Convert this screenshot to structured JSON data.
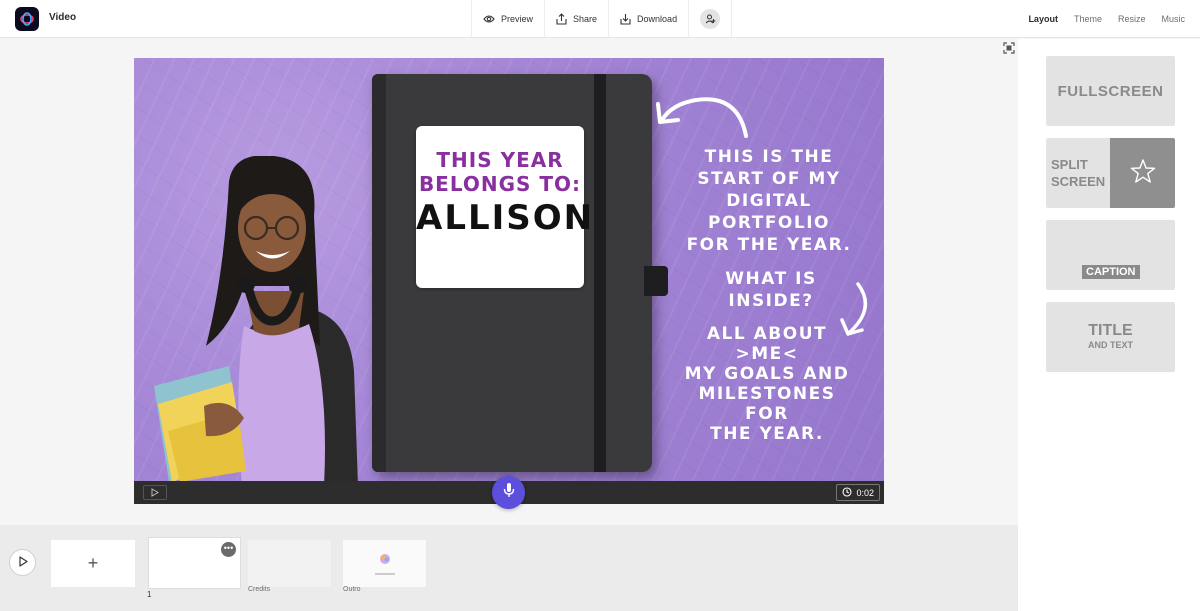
{
  "app": {
    "title": "Video"
  },
  "toolbar": {
    "preview_label": "Preview",
    "share_label": "Share",
    "download_label": "Download"
  },
  "right_tabs": [
    "Layout",
    "Theme",
    "Resize",
    "Music"
  ],
  "active_right_tab": "Layout",
  "slide": {
    "label_line1": "THIS YEAR",
    "label_line2": "BELONGS TO:",
    "name": "ALLISON",
    "text1": [
      "THIS IS THE",
      "START OF MY",
      "DIGITAL PORTFOLIO",
      "FOR THE YEAR."
    ],
    "text2": "WHAT IS INSIDE?",
    "text3": [
      "ALL ABOUT >ME<",
      "MY GOALS AND",
      "MILESTONES FOR",
      "THE YEAR."
    ],
    "timer": "0:02",
    "background_color": "#a486d6"
  },
  "layouts": {
    "fullscreen": "FULLSCREEN",
    "split_line1": "SPLIT",
    "split_line2": "SCREEN",
    "caption": "CAPTION",
    "title_main": "TITLE",
    "title_sub": "AND TEXT"
  },
  "timeline": {
    "add_label": "+",
    "slide_number": "1",
    "credits_label": "Credits",
    "outro_label": "Outro"
  },
  "colors": {
    "accent": "#5b4fdc"
  }
}
